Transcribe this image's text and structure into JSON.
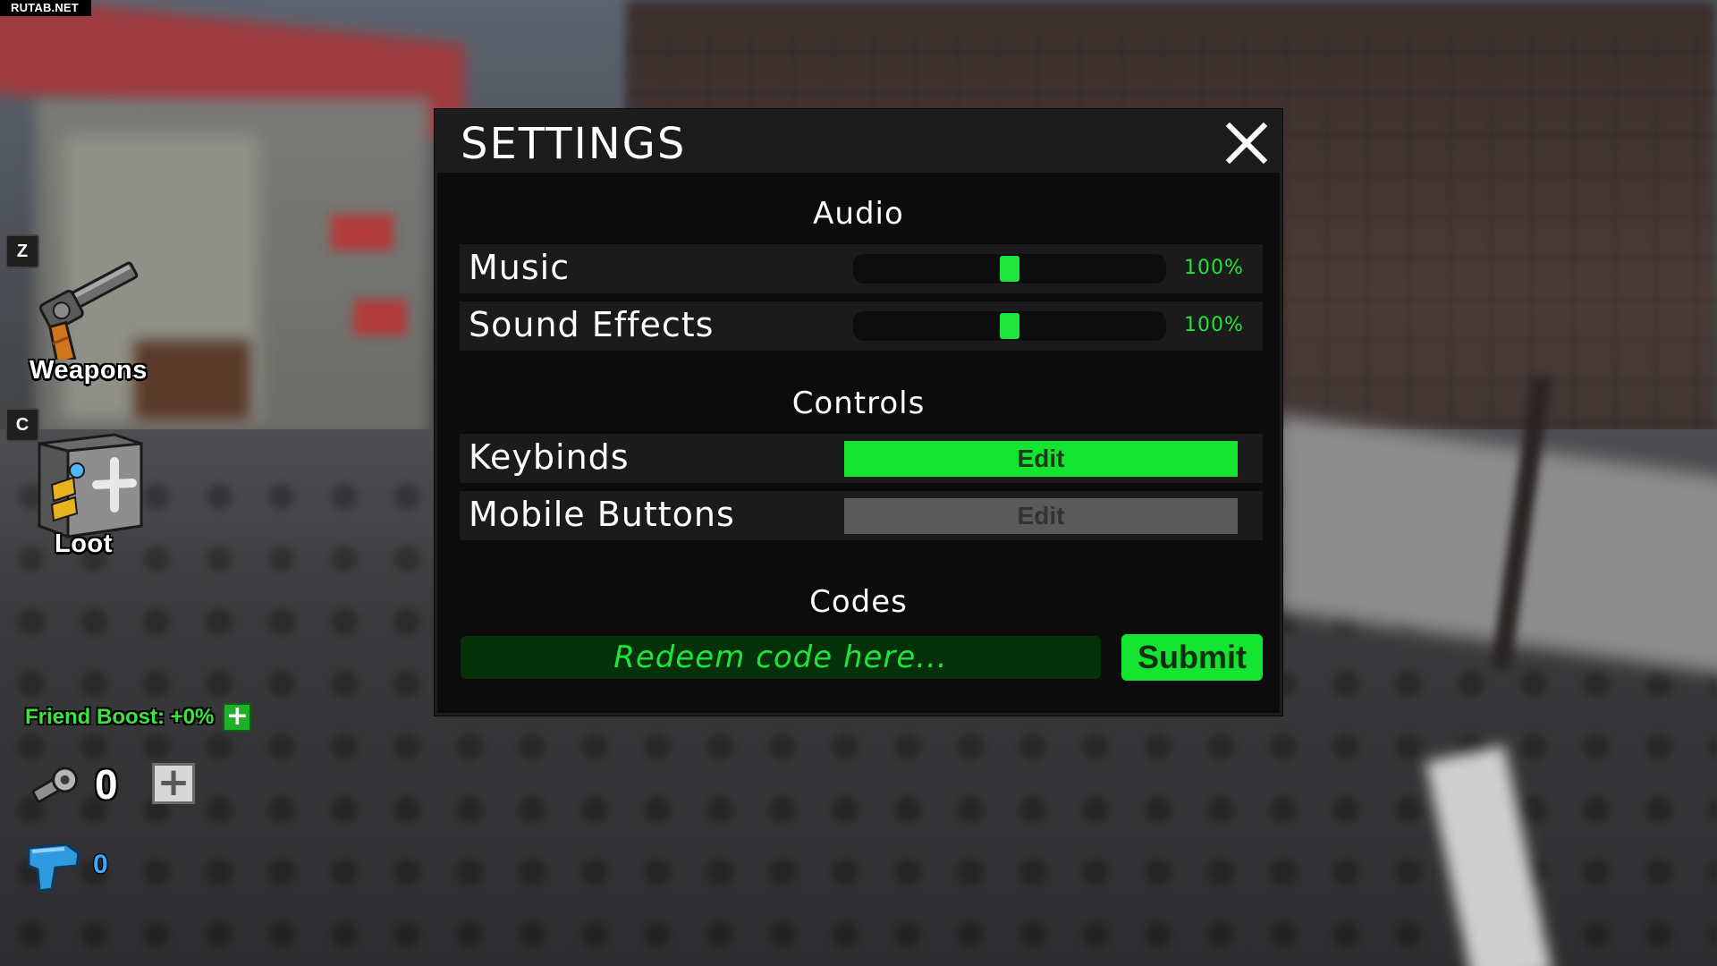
{
  "watermark": "RUTAB.NET",
  "hud": {
    "weapons": {
      "key": "Z",
      "label": "Weapons",
      "icon": "revolver-icon"
    },
    "loot": {
      "key": "C",
      "label": "Loot",
      "icon": "safe-icon"
    },
    "friend_boost": {
      "text": "Friend Boost: +0%",
      "plus": "+",
      "color": "#3fe23f"
    },
    "tickets": {
      "count": "0",
      "plus": "+",
      "icon": "wrench-icon"
    },
    "gems": {
      "count": "0",
      "icon": "blue-gun-icon",
      "color": "#39a8ff"
    }
  },
  "settings": {
    "title": "SETTINGS",
    "close_icon": "close-icon",
    "audio": {
      "heading": "Audio",
      "music": {
        "label": "Music",
        "value_text": "100%",
        "level": 0.5
      },
      "sound_effects": {
        "label": "Sound Effects",
        "value_text": "100%",
        "level": 0.5
      }
    },
    "controls": {
      "heading": "Controls",
      "keybinds": {
        "label": "Keybinds",
        "button": "Edit",
        "enabled": true
      },
      "mobile_buttons": {
        "label": "Mobile Buttons",
        "button": "Edit",
        "enabled": false
      }
    },
    "codes": {
      "heading": "Codes",
      "placeholder": "Redeem code here...",
      "value": "",
      "submit": "Submit"
    },
    "accent_color": "#1ee53a"
  }
}
